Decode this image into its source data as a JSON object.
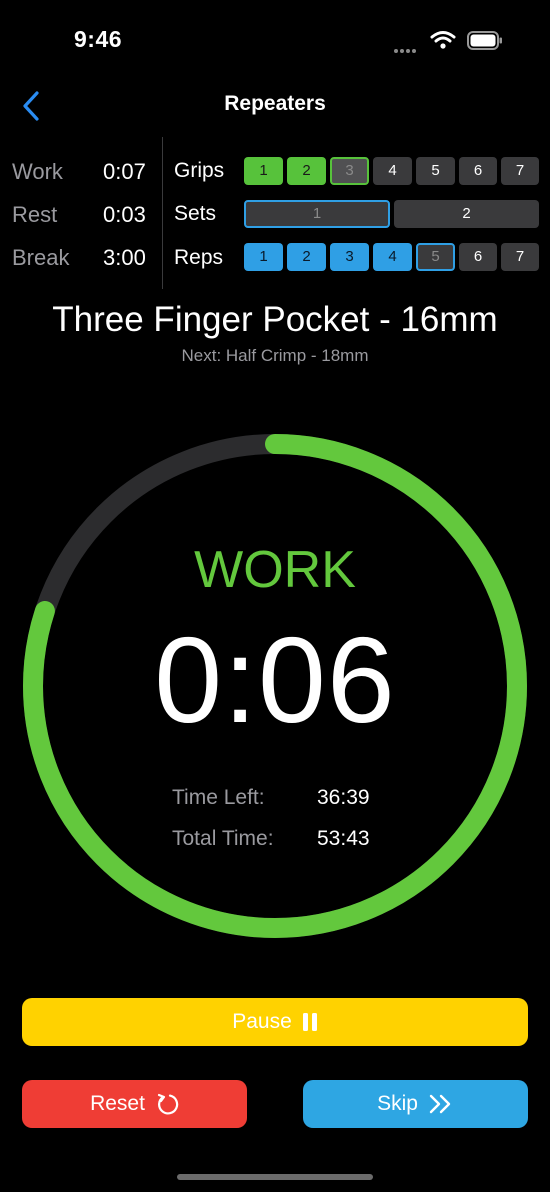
{
  "status_bar": {
    "time": "9:46"
  },
  "nav": {
    "title": "Repeaters"
  },
  "stats": [
    {
      "label": "Work",
      "value": "0:07"
    },
    {
      "label": "Rest",
      "value": "0:03"
    },
    {
      "label": "Break",
      "value": "3:00"
    }
  ],
  "grips": {
    "label": "Grips",
    "items": [
      "1",
      "2",
      "3",
      "4",
      "5",
      "6",
      "7"
    ],
    "current": 3
  },
  "sets": {
    "label": "Sets",
    "items": [
      "1",
      "2"
    ],
    "current": 1
  },
  "reps": {
    "label": "Reps",
    "items": [
      "1",
      "2",
      "3",
      "4",
      "5",
      "6",
      "7"
    ],
    "current": 5
  },
  "current_grip": "Three Finger Pocket - 16mm",
  "next_grip": "Next: Half Crimp - 18mm",
  "timer": {
    "phase": "WORK",
    "countdown": "0:06",
    "progress": 0.8,
    "time_left_label": "Time Left:",
    "time_left": "36:39",
    "total_time_label": "Total Time:",
    "total_time": "53:43"
  },
  "buttons": {
    "pause": "Pause",
    "reset": "Reset",
    "skip": "Skip"
  },
  "colors": {
    "work": "#63c83d",
    "reps": "#2f9fe5",
    "pause": "#ffd200",
    "reset": "#ef3d35",
    "skip": "#2ea6e3"
  }
}
